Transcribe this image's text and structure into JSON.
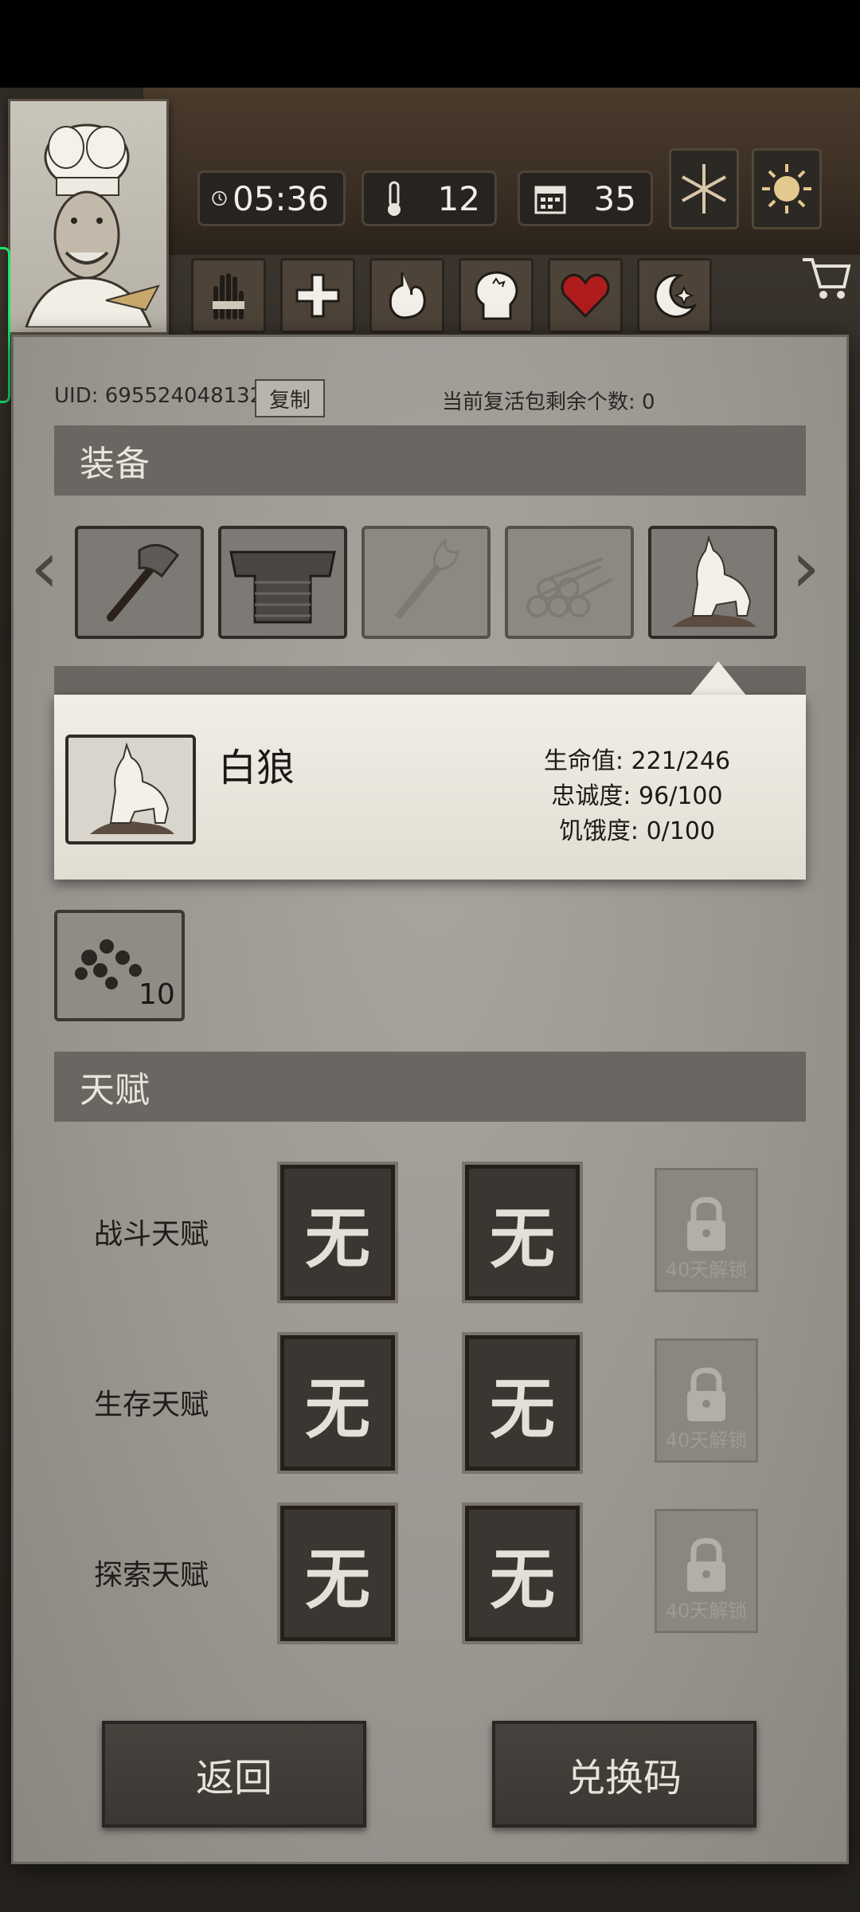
{
  "status": {
    "time": "05:36",
    "temperature": "12",
    "days": "35"
  },
  "stat_icons": [
    "hand-bandage-icon",
    "plus-icon",
    "stomach-icon",
    "head-brain-icon",
    "heart-icon",
    "moon-star-icon"
  ],
  "weather_icons": [
    "snowflake-icon",
    "sun-icon"
  ],
  "uid_label": "UID: 695524048132",
  "copy_label": "复制",
  "revive_label": "当前复活包剩余个数: 0",
  "equipment": {
    "title": "装备",
    "slots": [
      "axe",
      "chainmail-armor",
      "torch",
      "logs",
      "white-wolf"
    ]
  },
  "popup": {
    "name": "白狼",
    "health": "生命值: 221/246",
    "loyalty": "忠诚度: 96/100",
    "hunger": "饥饿度: 0/100"
  },
  "bag": {
    "item": "berries",
    "count": "10"
  },
  "talents": {
    "title": "天赋",
    "rows": [
      {
        "label": "战斗天赋",
        "slot1": "无",
        "slot2": "无",
        "locked": "40天解锁"
      },
      {
        "label": "生存天赋",
        "slot1": "无",
        "slot2": "无",
        "locked": "40天解锁"
      },
      {
        "label": "探索天赋",
        "slot1": "无",
        "slot2": "无",
        "locked": "40天解锁"
      }
    ]
  },
  "buttons": {
    "back": "返回",
    "redeem": "兑换码"
  },
  "colors": {
    "paper": "#9a9791",
    "section": "#6a6661",
    "heart": "#b01c1c"
  }
}
